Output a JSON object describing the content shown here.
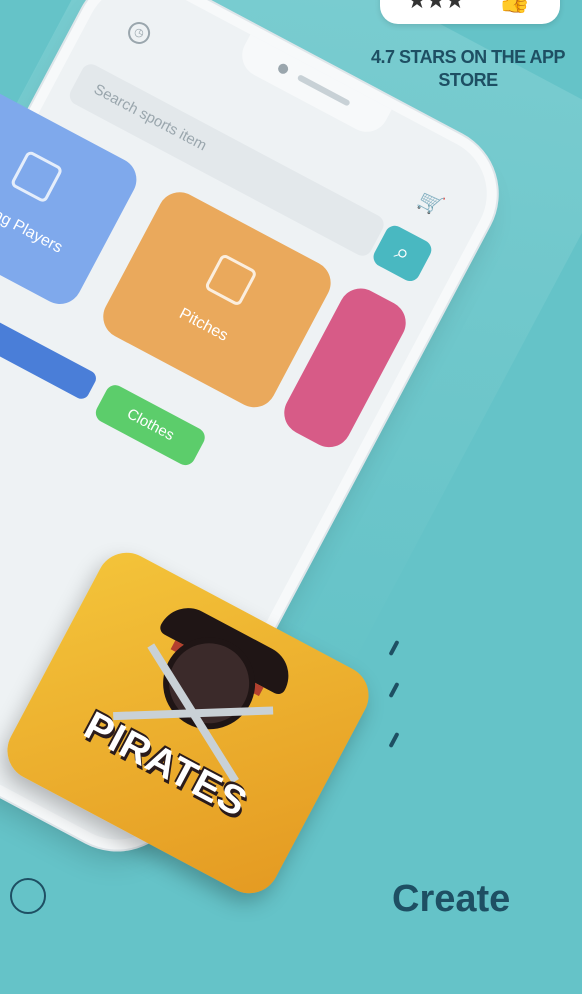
{
  "rating": {
    "stars_label": "★★★",
    "emoji": "👍",
    "text": "4.7 STARS ON THE APP STORE"
  },
  "phone": {
    "search_placeholder": "Search sports item",
    "cards": [
      {
        "label": "Sporting Players",
        "color": "#7fa9ec"
      },
      {
        "label": "Pitches",
        "color": "#eaa95c"
      },
      {
        "label": "",
        "color": "#d75b87"
      },
      {
        "label": "",
        "color": "#8d4fd8"
      },
      {
        "label": "",
        "color": "#4a7ed8"
      },
      {
        "label": "Clothes",
        "color": "#5ccd6b"
      }
    ]
  },
  "badge": {
    "title": "PIRATES"
  },
  "footer": {
    "title": "Create"
  },
  "colors": {
    "background": "#65c3c8",
    "accent": "#49b8c1",
    "text_dark": "#1e4f63"
  },
  "icons": [
    "clock-icon",
    "cart-icon",
    "search-icon",
    "pirate-skull-icon"
  ]
}
